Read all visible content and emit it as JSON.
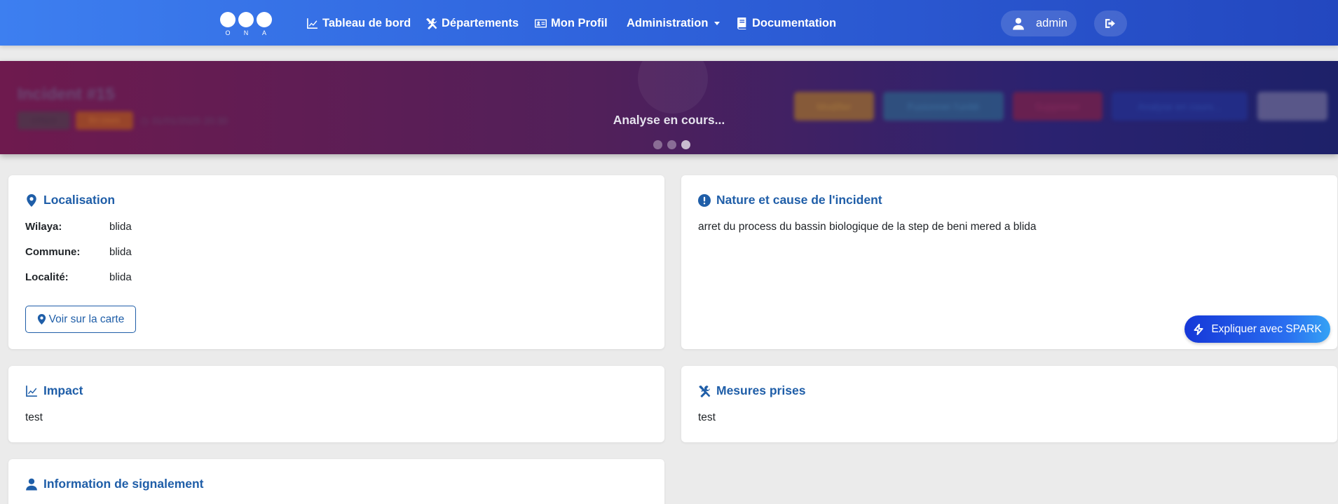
{
  "navbar": {
    "logo_letters": [
      "O",
      "N",
      "A"
    ],
    "items": [
      {
        "label": "Tableau de bord",
        "icon": "chart-line-icon"
      },
      {
        "label": "Départements",
        "icon": "tools-icon"
      },
      {
        "label": "Mon Profil",
        "icon": "id-card-icon"
      },
      {
        "label": "Administration",
        "icon": "",
        "dropdown": true
      },
      {
        "label": "Documentation",
        "icon": "book-icon"
      }
    ],
    "user": {
      "name": "admin",
      "icon": "user-icon"
    },
    "logout_icon": "logout-icon"
  },
  "banner": {
    "title": "Incident #15",
    "badges": [
      "critique",
      "En cours"
    ],
    "date": "31/01/2025 20:30",
    "actions": [
      "Modifier",
      "Fusionner l'unité",
      "Supprimer",
      "Analyse en cours...",
      ""
    ],
    "overlay_text": "Analyse en cours...",
    "colors": {
      "from": "#6e1a4e",
      "to": "#1d2169"
    }
  },
  "localisation": {
    "title": "Localisation",
    "rows": [
      {
        "label": "Wilaya:",
        "value": "blida"
      },
      {
        "label": "Commune:",
        "value": "blida"
      },
      {
        "label": "Localité:",
        "value": "blida"
      }
    ],
    "map_button": "Voir sur la carte"
  },
  "nature": {
    "title": "Nature et cause de l'incident",
    "text": "arret du process du bassin biologique de la step de beni mered a blida",
    "spark_button": "Expliquer avec SPARK"
  },
  "impact": {
    "title": "Impact",
    "text": "test"
  },
  "mesures": {
    "title": "Mesures prises",
    "text": "test"
  },
  "signalement": {
    "title": "Information de signalement"
  },
  "theme": {
    "primary": "#1f5ea8",
    "nav_start": "#3d7ff0",
    "nav_end": "#2347bf"
  }
}
